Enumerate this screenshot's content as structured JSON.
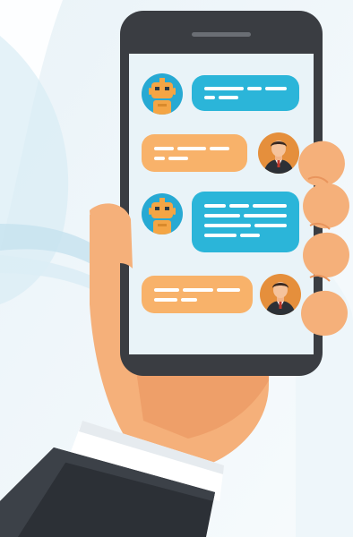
{
  "scene": {
    "subject": "hand-holding-smartphone-chat",
    "colors": {
      "background": "#f3f8fb",
      "background_swoosh": "#d6eaf4",
      "skin": "#f5b07a",
      "skin_shadow": "#e9955d",
      "sleeve_dark": "#2c3036",
      "sleeve_mid": "#3c4148",
      "shirt_cuff": "#ffffff",
      "phone_body": "#3a3d42",
      "phone_screen": "#e9f3f8",
      "bot_bubble": "#2bb5d9",
      "user_bubble": "#f8b26a",
      "bot_avatar_bg": "#27a9d3",
      "bot_face": "#f4a545",
      "user_avatar_bg": "#e58f3c"
    }
  },
  "chat": {
    "messages": [
      {
        "sender": "bot",
        "avatar": "robot-avatar",
        "text_lines": 2
      },
      {
        "sender": "user",
        "avatar": "man-avatar",
        "text_lines": 2
      },
      {
        "sender": "bot",
        "avatar": "robot-avatar",
        "text_lines": 4
      },
      {
        "sender": "user",
        "avatar": "man-avatar",
        "text_lines": 2
      }
    ]
  }
}
